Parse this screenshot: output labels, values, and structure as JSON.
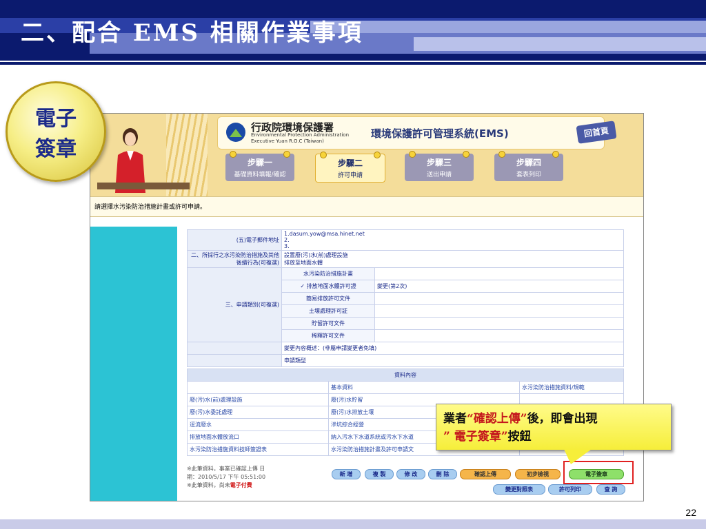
{
  "slide": {
    "title": "二、配合 EMS 相關作業事項",
    "page_number": "22",
    "badge_line1": "電子",
    "badge_line2": "簽章"
  },
  "app": {
    "org_zh": "行政院環境保護署",
    "org_en1": "Environmental Protection Administration",
    "org_en2": "Executive Yuan R.O.C (Taiwan)",
    "system_title": "環境保護許可管理系統(EMS)",
    "home_button": "回首頁",
    "steps": [
      {
        "title": "步驟一",
        "subtitle": "基礎資料填報/確認",
        "active": false
      },
      {
        "title": "步驟二",
        "subtitle": "許可申請",
        "active": true
      },
      {
        "title": "步驟三",
        "subtitle": "送出申請",
        "active": false
      },
      {
        "title": "步驟四",
        "subtitle": "套表列印",
        "active": false
      }
    ],
    "notice": "請選擇水污染防治措施計畫或許可申請。"
  },
  "form": {
    "email_label": "(五)電子郵件地址",
    "email_values": [
      "1.dasum.yow@msa.hinet.net",
      "2.",
      "3."
    ],
    "measure_label": "二、所採行之水污染防治措施及其他後續行為(可複選)",
    "measure_values": [
      "設置廢(污)水(前)處理設施",
      "排放至地面水體"
    ],
    "category_label": "三、申請類別(可複選)",
    "categories": [
      {
        "name": "水污染防治措施計畫",
        "checked": false,
        "note": ""
      },
      {
        "name": "排放地面水體許可證",
        "checked": true,
        "note": "變更(第2次)"
      },
      {
        "name": "簡易排放許可文件",
        "checked": false,
        "note": ""
      },
      {
        "name": "土壤處理許可証",
        "checked": false,
        "note": ""
      },
      {
        "name": "貯留許可文件",
        "checked": false,
        "note": ""
      },
      {
        "name": "稀釋許可文件",
        "checked": false,
        "note": ""
      }
    ],
    "change_summary": "變更內容概述：(非屬申請變更者免填)",
    "apply_type": "申請類型",
    "section_header": "資料內容",
    "col_basic": "基本資料",
    "col_measure": "水污染防治措施資料/規範",
    "rows": [
      [
        "",
        "基本資料",
        "水污染防治措施資料/規範"
      ],
      [
        "廢(污)水(前)處理設施",
        "廢(污)水貯留",
        ""
      ],
      [
        "廢(污)水委託處理",
        "廢(污)水排放土壤",
        ""
      ],
      [
        "逕流廢水",
        "滲坑綜合經營",
        ""
      ],
      [
        "排放地面水體放流口",
        "納入污水下水道系統或污水下水道",
        ""
      ],
      [
        "水污染防治措施資料技師簽證表",
        "水污染防治措施計畫及許可申請文",
        ""
      ]
    ]
  },
  "footer": {
    "note_line1": "※此筆資料，事業已確認上傳 日",
    "note_line2": "期：2010/5/17 下午 05:51:00",
    "note_line3_prefix": "※此筆資料，尚未",
    "note_line3_red": "電子付費"
  },
  "buttons": {
    "add": "新 增",
    "copy": "複 製",
    "edit": "修 改",
    "delete": "刪 除",
    "confirm_upload": "確認上傳",
    "precheck": "初步檢視",
    "e_sign": "電子簽章",
    "compare": "變更對照表",
    "print": "許可列印",
    "query": "查 詢"
  },
  "callout": {
    "part1": "業者",
    "highlight1": "“確認上傳”",
    "part2": "後，即會出現",
    "highlight2": "” 電子簽章”",
    "part3": "按鈕"
  },
  "colors": {
    "header_navy": "#0b1a6e",
    "sidebar_cyan": "#2cc3d4",
    "callout_yellow": "#f6ee3a",
    "highlight_red": "#c4161c"
  }
}
